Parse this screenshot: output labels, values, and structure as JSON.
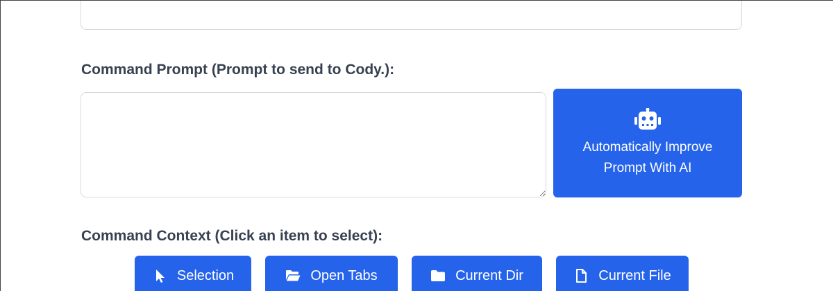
{
  "prompt_section": {
    "label": "Command Prompt (Prompt to send to Cody.):",
    "textarea_value": "",
    "improve_button": {
      "icon": "robot-icon",
      "line1": "Automatically Improve",
      "line2": "Prompt With AI"
    }
  },
  "context_section": {
    "label": "Command Context (Click an item to select):",
    "buttons": [
      {
        "label": "Selection",
        "icon": "cursor-icon"
      },
      {
        "label": "Open Tabs",
        "icon": "folder-open-icon"
      },
      {
        "label": "Current Dir",
        "icon": "folder-icon"
      },
      {
        "label": "Current File",
        "icon": "file-icon"
      }
    ]
  },
  "colors": {
    "accent": "#2563eb",
    "label_text": "#374151",
    "border": "#d9d9d9"
  }
}
